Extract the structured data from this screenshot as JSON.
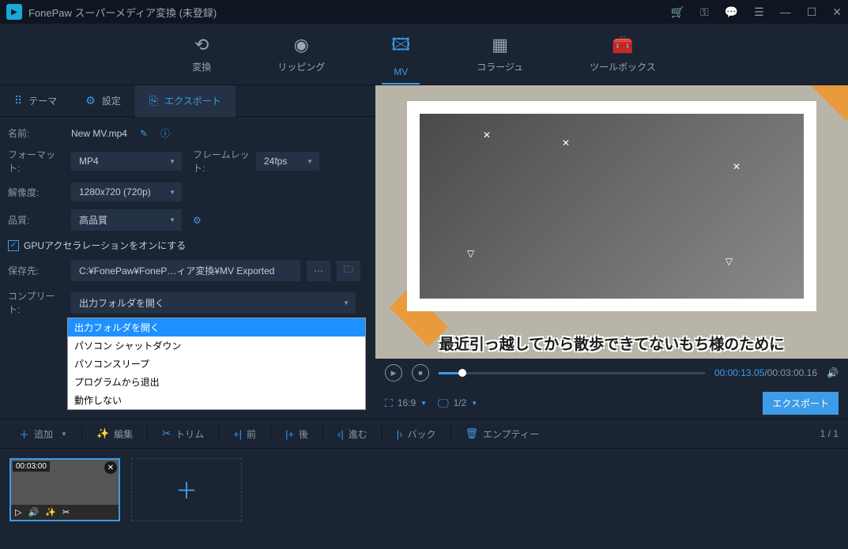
{
  "titlebar": {
    "app_name": "FonePaw スーパーメディア変換 (未登録)"
  },
  "nav": {
    "convert": "変換",
    "ripping": "リッピング",
    "mv": "MV",
    "collage": "コラージュ",
    "toolbox": "ツールボックス"
  },
  "tabs": {
    "theme": "テーマ",
    "settings": "設定",
    "export": "エクスポート"
  },
  "form": {
    "name_label": "名前:",
    "name_value": "New MV.mp4",
    "format_label": "フォーマット:",
    "format_value": "MP4",
    "framerate_label": "フレームレット:",
    "framerate_value": "24fps",
    "resolution_label": "解像度:",
    "resolution_value": "1280x720 (720p)",
    "quality_label": "品質:",
    "quality_value": "高品質",
    "gpu_accel": "GPUアクセラレーションをオンにする",
    "save_to_label": "保存先:",
    "save_to_path": "C:¥FonePaw¥FoneP…ィア変換¥MV Exported",
    "complete_label": "コンプリート:",
    "complete_value": "出力フォルダを開く",
    "complete_options": [
      "出力フォルダを開く",
      "パソコン シャットダウン",
      "パソコンスリープ",
      "プログラムから退出",
      "動作しない"
    ],
    "export_button": "エクスポート"
  },
  "preview": {
    "caption": "最近引っ越してから散歩できてないもち様のために",
    "time_current": "00:00:13.05",
    "time_total": "00:03:00.16",
    "aspect": "16:9",
    "pages": "1/2",
    "export_button": "エクスポート"
  },
  "bottom_toolbar": {
    "add": "追加",
    "edit": "編集",
    "trim": "トリム",
    "before": "前",
    "after": "後",
    "forward": "進む",
    "back": "バック",
    "empty": "エンプティー",
    "pagination": "1 / 1"
  },
  "timeline": {
    "clip_duration": "00:03:00"
  }
}
